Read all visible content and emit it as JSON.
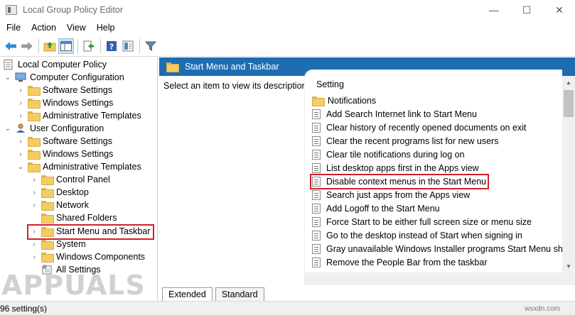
{
  "window": {
    "title": "Local Group Policy Editor",
    "minimize_glyph": "—",
    "maximize_glyph": "☐",
    "close_glyph": "✕"
  },
  "menu": [
    "File",
    "Action",
    "View",
    "Help"
  ],
  "toolbar": {
    "buttons": [
      "back-arrow-icon",
      "forward-arrow-icon",
      "up-folder-icon",
      "show-hide-tree-icon",
      "export-list-icon",
      "help-icon",
      "properties-icon",
      "filter-icon"
    ]
  },
  "tree": {
    "root": "Local Computer Policy",
    "computer_config": "Computer Configuration",
    "cc_software": "Software Settings",
    "cc_windows": "Windows Settings",
    "cc_admin": "Administrative Templates",
    "user_config": "User Configuration",
    "uc_software": "Software Settings",
    "uc_windows": "Windows Settings",
    "uc_admin": "Administrative Templates",
    "control_panel": "Control Panel",
    "desktop": "Desktop",
    "network": "Network",
    "shared_folders": "Shared Folders",
    "start_menu": "Start Menu and Taskbar",
    "system": "System",
    "windows_components": "Windows Components",
    "all_settings": "All Settings"
  },
  "panel": {
    "header": "Start Menu and Taskbar",
    "description": "Select an item to view its description.",
    "column_header": "Setting",
    "items": [
      "Notifications",
      "Add Search Internet link to Start Menu",
      "Clear history of recently opened documents on exit",
      "Clear the recent programs list for new users",
      "Clear tile notifications during log on",
      "List desktop apps first in the Apps view",
      "Disable context menus in the Start Menu",
      "Search just apps from the Apps view",
      "Add Logoff to the Start Menu",
      "Force Start to be either full screen size or menu size",
      "Go to the desktop instead of Start when signing in",
      "Gray unavailable Windows Installer programs Start Menu sh...",
      "Remove the People Bar from the taskbar"
    ]
  },
  "tabs": [
    "Extended",
    "Standard"
  ],
  "status": "96 setting(s)",
  "watermark": {
    "logo": "APPUALS",
    "site": "wsxdn.com"
  },
  "colors": {
    "header_blue": "#1e6db3",
    "highlight_red": "#d0202a",
    "folder_yellow": "#f3cd63"
  }
}
